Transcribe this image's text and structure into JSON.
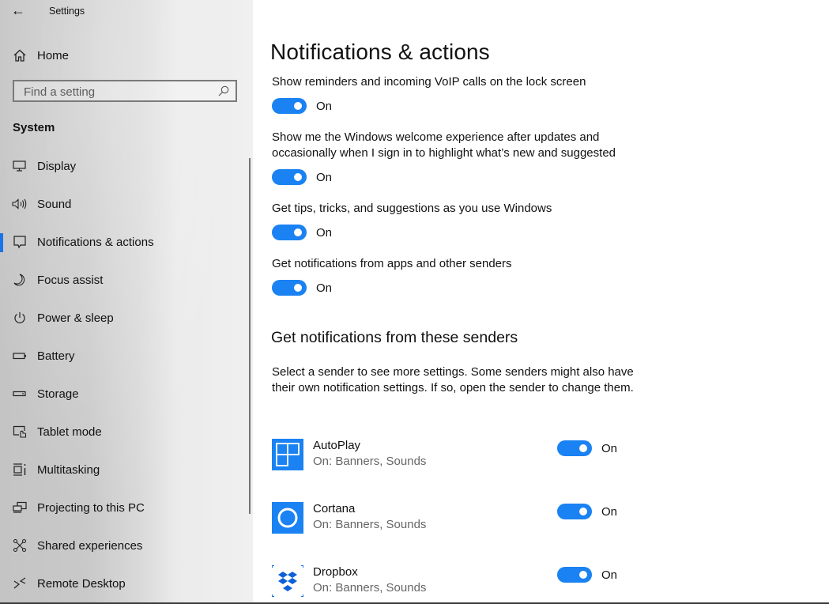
{
  "window": {
    "title": "Settings",
    "back_label": "←"
  },
  "sidebar": {
    "home_label": "Home",
    "search": {
      "placeholder": "Find a setting",
      "value": ""
    },
    "section_label": "System",
    "items": [
      {
        "label": "Display",
        "icon": "display-icon",
        "active": false
      },
      {
        "label": "Sound",
        "icon": "sound-icon",
        "active": false
      },
      {
        "label": "Notifications & actions",
        "icon": "notifications-icon",
        "active": true
      },
      {
        "label": "Focus assist",
        "icon": "moon-icon",
        "active": false
      },
      {
        "label": "Power & sleep",
        "icon": "power-icon",
        "active": false
      },
      {
        "label": "Battery",
        "icon": "battery-icon",
        "active": false
      },
      {
        "label": "Storage",
        "icon": "storage-icon",
        "active": false
      },
      {
        "label": "Tablet mode",
        "icon": "tablet-mode-icon",
        "active": false
      },
      {
        "label": "Multitasking",
        "icon": "multitasking-icon",
        "active": false
      },
      {
        "label": "Projecting to this PC",
        "icon": "projecting-icon",
        "active": false
      },
      {
        "label": "Shared experiences",
        "icon": "shared-experiences-icon",
        "active": false
      },
      {
        "label": "Remote Desktop",
        "icon": "remote-desktop-icon",
        "active": false
      }
    ]
  },
  "main": {
    "title": "Notifications & actions",
    "settings": [
      {
        "description": "Show reminders and incoming VoIP calls on the lock screen",
        "state": "On",
        "on": true
      },
      {
        "description": "Show me the Windows welcome experience after updates and occasionally when I sign in to highlight what’s new and suggested",
        "state": "On",
        "on": true
      },
      {
        "description": "Get tips, tricks, and suggestions as you use Windows",
        "state": "On",
        "on": true
      },
      {
        "description": "Get notifications from apps and other senders",
        "state": "On",
        "on": true
      }
    ],
    "senders_heading": "Get notifications from these senders",
    "senders_description": "Select a sender to see more settings. Some senders might also have their own notification settings. If so, open the sender to change them.",
    "senders": [
      {
        "name": "AutoPlay",
        "status": "On: Banners, Sounds",
        "state": "On",
        "icon": "autoplay-icon"
      },
      {
        "name": "Cortana",
        "status": "On: Banners, Sounds",
        "state": "On",
        "icon": "cortana-icon"
      },
      {
        "name": "Dropbox",
        "status": "On: Banners, Sounds",
        "state": "On",
        "icon": "dropbox-icon"
      }
    ]
  },
  "colors": {
    "accent": "#1a82f2",
    "selection_bar": "#1a73e8"
  }
}
